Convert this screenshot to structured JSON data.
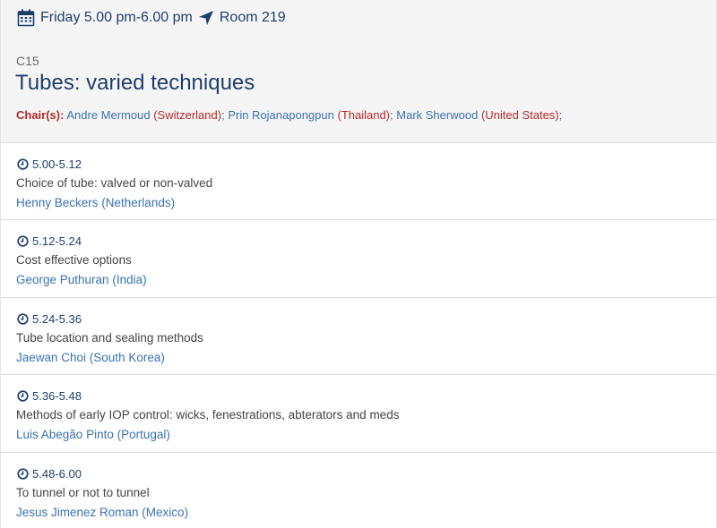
{
  "session": {
    "schedule": "Friday 5.00 pm-6.00 pm",
    "room": "Room 219",
    "code": "C15",
    "title": "Tubes: varied techniques",
    "chairs_label": "Chair(s):",
    "chairs": [
      {
        "name": "Andre Mermoud",
        "country": "(Switzerland)"
      },
      {
        "name": "Prin Rojanapongpun",
        "country": "(Thailand)"
      },
      {
        "name": "Mark Sherwood",
        "country": "(United States)"
      }
    ],
    "chair_separator": ";"
  },
  "talks": [
    {
      "time": "5.00-5.12",
      "title": "Choice of tube: valved or non-valved",
      "speaker": "Henny Beckers (Netherlands)"
    },
    {
      "time": "5.12-5.24",
      "title": "Cost effective options",
      "speaker": "George Puthuran (India)"
    },
    {
      "time": "5.24-5.36",
      "title": "Tube location and sealing methods",
      "speaker": "Jaewan Choi (South Korea)"
    },
    {
      "time": "5.36-5.48",
      "title": "Methods of early IOP control: wicks, fenestrations, abterators and meds",
      "speaker": "Luis Abegão Pinto (Portugal)"
    },
    {
      "time": "5.48-6.00",
      "title": "To tunnel or not to tunnel",
      "speaker": "Jesus Jimenez Roman (Mexico)"
    }
  ],
  "icons": {
    "calendar": "calendar-icon",
    "navigation": "location-arrow-icon",
    "clock": "clock-icon"
  }
}
